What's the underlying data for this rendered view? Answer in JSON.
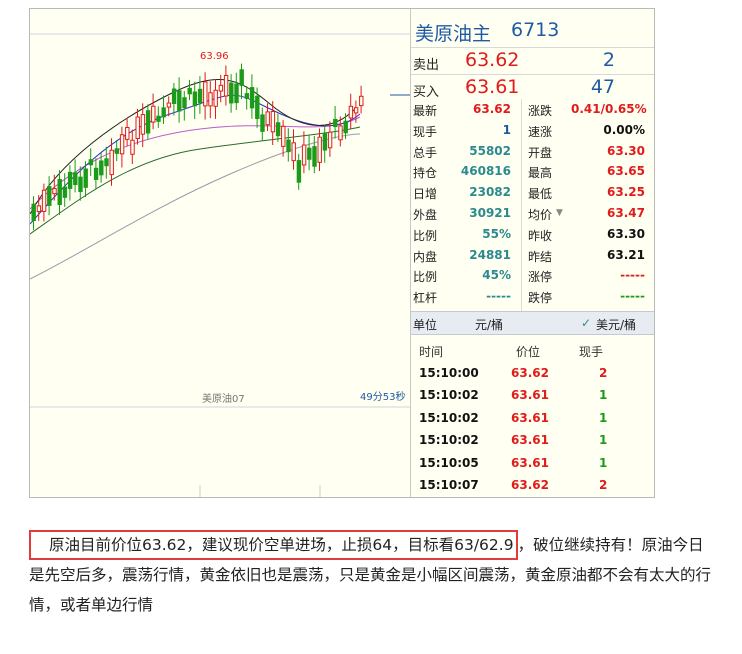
{
  "chart": {
    "high_label": "63.96",
    "contract_label": "美原油07",
    "countdown": "49分53秒"
  },
  "panel": {
    "name": "美原油主",
    "code": "6713",
    "sell": {
      "label": "卖出",
      "price": "63.62",
      "vol": "2"
    },
    "buy": {
      "label": "买入",
      "price": "63.61",
      "vol": "47"
    },
    "stats": [
      {
        "k": "最新",
        "v": "63.62",
        "vc": "#e01b1b",
        "k2": "涨跌",
        "v2": "0.41/0.65%",
        "v2c": "#e01b1b"
      },
      {
        "k": "现手",
        "v": "1",
        "vc": "#1f5aa6",
        "k2": "速涨",
        "v2": "0.00%",
        "v2c": "#111"
      },
      {
        "k": "总手",
        "v": "55802",
        "vc": "#2c8a8f",
        "k2": "开盘",
        "v2": "63.30",
        "v2c": "#e01b1b"
      },
      {
        "k": "持仓",
        "v": "460816",
        "vc": "#2c8a8f",
        "k2": "最高",
        "v2": "63.65",
        "v2c": "#e01b1b"
      },
      {
        "k": "日增",
        "v": "23082",
        "vc": "#2c8a8f",
        "k2": "最低",
        "v2": "63.25",
        "v2c": "#e01b1b"
      },
      {
        "k": "外盘",
        "v": "30921",
        "vc": "#2c8a8f",
        "k2": "均价",
        "v2": "63.47",
        "v2c": "#e01b1b"
      },
      {
        "k": "比例",
        "v": "55%",
        "vc": "#2c8a8f",
        "k2": "昨收",
        "v2": "63.30",
        "v2c": "#111"
      },
      {
        "k": "内盘",
        "v": "24881",
        "vc": "#2c8a8f",
        "k2": "昨结",
        "v2": "63.21",
        "v2c": "#111"
      },
      {
        "k": "比例",
        "v": "45%",
        "vc": "#2c8a8f",
        "k2": "涨停",
        "v2": "-----",
        "v2c": "#e01b1b"
      },
      {
        "k": "杠杆",
        "v": "-----",
        "vc": "#2c8a8f",
        "k2": "跌停",
        "v2": "-----",
        "v2c": "#1a9b1a"
      }
    ],
    "unit_row": {
      "label": "单位",
      "left": "元/桶",
      "right": "美元/桶",
      "check": "✓"
    },
    "ticks_header": {
      "time": "时间",
      "price": "价位",
      "qty": "现手"
    },
    "ticks": [
      {
        "time": "15:10:00",
        "price": "63.62",
        "qty": "2",
        "qc": "#e01b1b"
      },
      {
        "time": "15:10:02",
        "price": "63.61",
        "qty": "1",
        "qc": "#1a9b1a"
      },
      {
        "time": "15:10:02",
        "price": "63.61",
        "qty": "1",
        "qc": "#1a9b1a"
      },
      {
        "time": "15:10:02",
        "price": "63.61",
        "qty": "1",
        "qc": "#1a9b1a"
      },
      {
        "time": "15:10:05",
        "price": "63.61",
        "qty": "1",
        "qc": "#1a9b1a"
      },
      {
        "time": "15:10:07",
        "price": "63.62",
        "qty": "2",
        "qc": "#e01b1b"
      }
    ]
  },
  "note": {
    "boxed": "原油目前价位63.62，建议现价空单进场，止损64，目标看63/62.9",
    "rest": "，破位继续持有！原油今日是先空后多，震荡行情，黄金依旧也是震荡，只是黄金是小幅区间震荡，黄金原油都不会有太大的行情，或者单边行情"
  },
  "colors": {
    "up": "#e01b1b",
    "down": "#1a9b1a",
    "blue": "#1f5aa6"
  }
}
